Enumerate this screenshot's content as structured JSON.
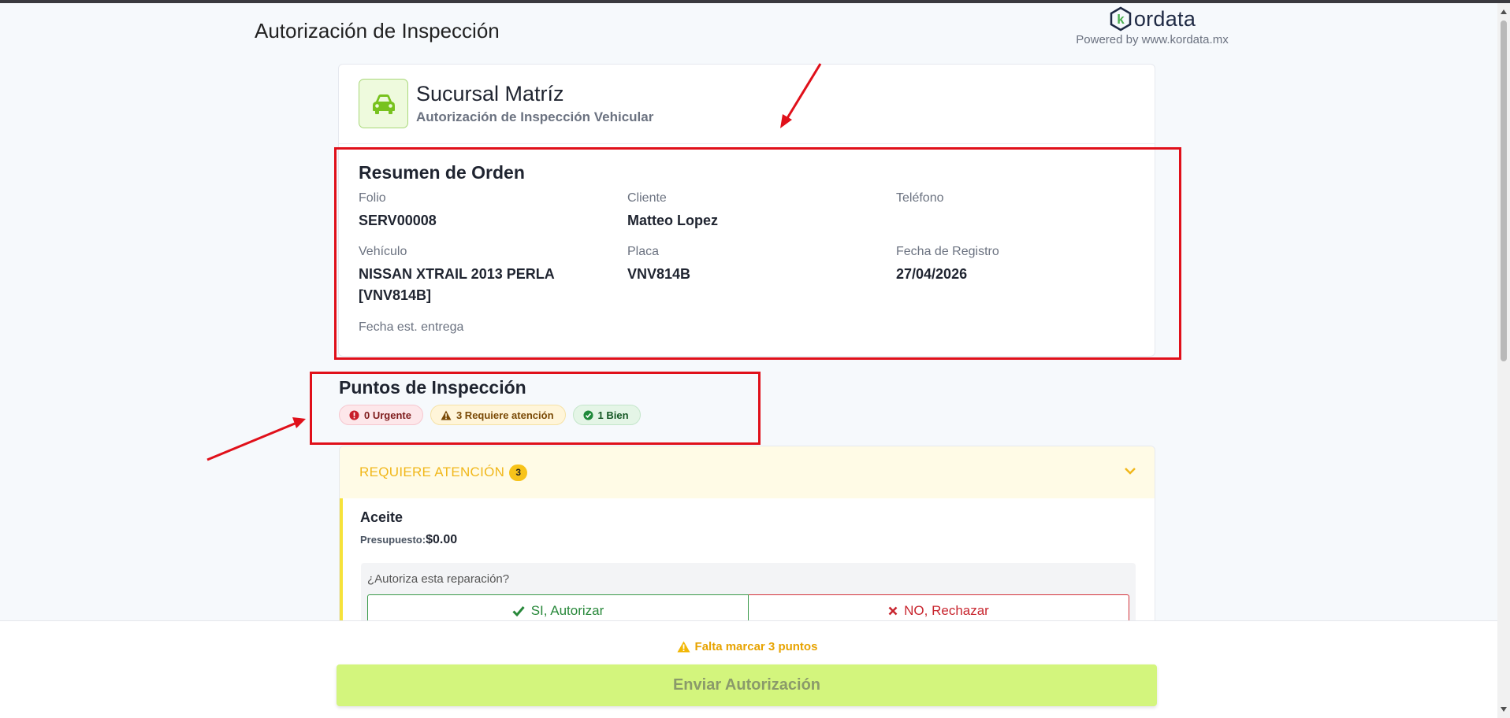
{
  "page": {
    "title": "Autorización de Inspección"
  },
  "brand": {
    "name": "ordata",
    "letter": "k",
    "powered_by": "Powered by www.kordata.mx"
  },
  "branch": {
    "name": "Sucursal Matríz",
    "subtitle": "Autorización de Inspección Vehicular",
    "icon": "car-icon"
  },
  "summary": {
    "title": "Resumen de Orden",
    "fields": [
      {
        "label": "Folio",
        "value": "SERV00008"
      },
      {
        "label": "Cliente",
        "value": "Matteo Lopez"
      },
      {
        "label": "Teléfono",
        "value": ""
      },
      {
        "label": "Vehículo",
        "value": "NISSAN XTRAIL 2013 PERLA [VNV814B]"
      },
      {
        "label": "Placa",
        "value": "VNV814B"
      },
      {
        "label": "Fecha de Registro",
        "value": "27/04/2026"
      },
      {
        "label": "Fecha est. entrega",
        "value": ""
      }
    ]
  },
  "inspection": {
    "title": "Puntos de Inspección",
    "chips": {
      "urgent": "0 Urgente",
      "attention": "3 Requiere atención",
      "good": "1 Bien"
    }
  },
  "section": {
    "label": "REQUIERE ATENCIÓN",
    "count": "3",
    "item": {
      "name": "Aceite",
      "budget_label": "Presupuesto:",
      "budget_value": "$0.00",
      "question": "¿Autoriza esta reparación?",
      "yes_label": "SI, Autorizar",
      "no_label": "NO, Rechazar"
    }
  },
  "footer": {
    "warning": "Falta marcar 3 puntos",
    "submit_label": "Enviar Autorización"
  },
  "colors": {
    "accent_green": "#d3f57d",
    "attention": "#f1b71a",
    "annotation_red": "#e0101a"
  }
}
